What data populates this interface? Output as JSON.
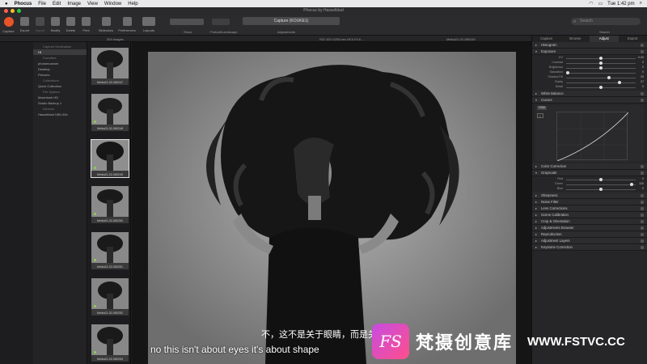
{
  "menubar": {
    "items": [
      "Phocus",
      "File",
      "Edit",
      "Image",
      "View",
      "Window",
      "Help"
    ],
    "clock": "Tue 1:42 pm"
  },
  "window": {
    "title": "Phocus by Hasselblad"
  },
  "toolbar": {
    "buttons": [
      "Capture",
      "Export",
      "Import",
      "Modify",
      "Delete",
      "Print",
      "Slideshow",
      "Preferences",
      "Layouts"
    ],
    "capture_label": "Capture (KOUKE1)",
    "show_label": "Show",
    "portrait_label": "Portrait/Landscape",
    "adjustments_label": "Adjustments",
    "search_placeholder": "Search",
    "search_label": "Search"
  },
  "subbar": {
    "count": "393 images",
    "exif": "ISO 100  1/250 sec  f/8.0  f:5.6  ...",
    "filename": "Meika21-02-080249"
  },
  "sidebar": {
    "items": [
      {
        "label": "Capture Destination",
        "type": "head"
      },
      {
        "label": "Hf",
        "type": "sel"
      },
      {
        "label": "Favorites",
        "type": "head"
      },
      {
        "label": "photomuseum",
        "type": "item"
      },
      {
        "label": "Desktop",
        "type": "item"
      },
      {
        "label": "Pictures",
        "type": "item"
      },
      {
        "label": "Collections",
        "type": "head"
      },
      {
        "label": "Quick Collection",
        "type": "item"
      },
      {
        "label": "File System",
        "type": "head"
      },
      {
        "label": "Macintosh HD",
        "type": "item"
      },
      {
        "label": "Studio Backup 1",
        "type": "item"
      },
      {
        "label": "Devices",
        "type": "head"
      },
      {
        "label": "Hasselblad H6D-50c",
        "type": "item"
      }
    ]
  },
  "thumbnails": [
    {
      "name": "Meika21-02-080247",
      "selected": false
    },
    {
      "name": "Meika21-02-080248",
      "selected": false
    },
    {
      "name": "Meika21-02-080249",
      "selected": true
    },
    {
      "name": "Meika21-02-080250",
      "selected": false
    },
    {
      "name": "Meika21-02-080251",
      "selected": false
    },
    {
      "name": "Meika21-02-080252",
      "selected": false
    },
    {
      "name": "Meika21-02-080253",
      "selected": false
    }
  ],
  "rightpanel": {
    "tabs": [
      "Capture",
      "Browse",
      "Adjust",
      "Export"
    ],
    "active_tab": "Adjust",
    "tools_top": [
      "Histogram",
      "Exposure"
    ],
    "exposure_sliders": [
      {
        "label": "EV",
        "value": "0.00",
        "knob": 0.5
      },
      {
        "label": "Contrast",
        "value": "0",
        "knob": 0.5
      },
      {
        "label": "Brightness",
        "value": "0",
        "knob": 0.5
      },
      {
        "label": "Saturation",
        "value": "0",
        "knob": 0.0
      },
      {
        "label": "Shadow Fill",
        "value": "29",
        "knob": 0.62
      },
      {
        "label": "Clarity",
        "value": "37",
        "knob": 0.78
      },
      {
        "label": "Detail",
        "value": "0",
        "knob": 0.5
      }
    ],
    "tools_mid": [
      "White Balance",
      "Curves"
    ],
    "curve_channel": "RGB",
    "tools_mid2": [
      "Color Correction",
      "Grayscale"
    ],
    "grayscale_sliders": [
      {
        "label": "Red",
        "value": "0",
        "knob": 0.5
      },
      {
        "label": "Green",
        "value": "100",
        "knob": 0.96
      },
      {
        "label": "Blue",
        "value": "0",
        "knob": 0.5
      }
    ],
    "tools_bottom": [
      "Sharpness",
      "Noise Filter",
      "Lens Corrections",
      "Scene Calibration",
      "Crop & Orientation",
      "Adjustments Browser",
      "Reproduction",
      "Adjustment Layers",
      "Keystone Correction"
    ]
  },
  "subtitles": {
    "cn": "不，这不是关于眼睛，而是关于",
    "en": "no this isn't about eyes it's about shape"
  },
  "watermark": {
    "logo": "FS",
    "name": "梵摄创意库",
    "site": "WWW.FSTVC.CC"
  },
  "colors": {
    "accent_capture": "#e8542a",
    "traffic_red": "#ff5f57",
    "traffic_yellow": "#febc2e",
    "traffic_green": "#28c840",
    "rating_dot": "#8fd14f"
  }
}
